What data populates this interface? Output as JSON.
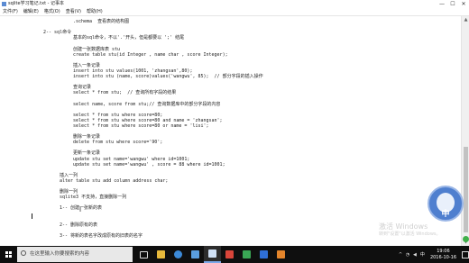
{
  "window": {
    "title": "sqlite学习笔记.txt - 记事本",
    "minimize": "—",
    "maximize": "☐",
    "close": "✕"
  },
  "menu": [
    "文件(F)",
    "编辑(E)",
    "格式(O)",
    "查看(V)",
    "帮助(H)"
  ],
  "editor": {
    "lines": [
      {
        "text": ".schema  查看表的结构图",
        "col": 27,
        "row": 0
      },
      {
        "text": "2-- sql命令",
        "col": 16,
        "row": 2
      },
      {
        "text": "基本的sql命令，不以'.'开头，但是都要以 ';' 结尾",
        "col": 27,
        "row": 3
      },
      {
        "text": "创建一张数据库表 stu",
        "col": 27,
        "row": 5
      },
      {
        "text": "create table stu(id Integer , name char , score Integer);",
        "col": 27,
        "row": 6
      },
      {
        "text": "插入一条记录",
        "col": 27,
        "row": 8
      },
      {
        "text": "insert into stu values(1001, 'zhangsan',80);",
        "col": 27,
        "row": 9
      },
      {
        "text": "insert into stu (name, score)values('wangwu', 85);  // 部分字段的插入操作",
        "col": 27,
        "row": 10
      },
      {
        "text": "查询记录",
        "col": 27,
        "row": 12
      },
      {
        "text": "select * from stu;  // 查询所有字段的结果",
        "col": 27,
        "row": 13
      },
      {
        "text": "select name, score from stu;// 查询数据库中的部分字段的内容",
        "col": 27,
        "row": 15
      },
      {
        "text": "select * from stu where score=80;",
        "col": 27,
        "row": 17
      },
      {
        "text": "select * from stu where score=80 and name = 'zhangsan';",
        "col": 27,
        "row": 18
      },
      {
        "text": "select * from stu where score=80 or name = 'lisi';",
        "col": 27,
        "row": 19
      },
      {
        "text": "删除一条记录",
        "col": 27,
        "row": 21
      },
      {
        "text": "delete from stu where score='90';",
        "col": 27,
        "row": 22
      },
      {
        "text": "更新一条记录",
        "col": 27,
        "row": 24
      },
      {
        "text": "update stu set name='wangwu' where id=1001;",
        "col": 27,
        "row": 25
      },
      {
        "text": "update stu set name='wangwu' , score = 88 where id=1001;",
        "col": 27,
        "row": 26
      },
      {
        "text": "插入一列",
        "col": 22,
        "row": 28
      },
      {
        "text": "alter table stu add column address char;",
        "col": 22,
        "row": 29
      },
      {
        "text": "删除一列",
        "col": 22,
        "row": 31
      },
      {
        "text": "sqlite3 不支持，直接删除一列",
        "col": 22,
        "row": 32
      },
      {
        "text": "1-- 创建一张新的表",
        "col": 22,
        "row": 34
      },
      {
        "text": "2-- 删除原有的表",
        "col": 22,
        "row": 37
      },
      {
        "text": "3-- 将新的表名字改成原有的旧表的名字",
        "col": 22,
        "row": 39
      }
    ]
  },
  "watermark": {
    "title": "激活 Windows",
    "subtitle": "转到\"设置\"以激活 Windows。"
  },
  "assistant": {
    "label": "中"
  },
  "taskbar": {
    "search_placeholder": "在这里输入你要搜索的内容",
    "apps": [
      "task-view",
      "file-explorer",
      "browser",
      "store",
      "notepad",
      "app-red",
      "app-green",
      "app-blue",
      "app-orange"
    ],
    "tray": {
      "lang": "中",
      "time": "19:06",
      "date": "2016-10-16"
    }
  },
  "colors": {
    "taskbar": "#0f0f0f",
    "accent": "#7aa7e8"
  }
}
